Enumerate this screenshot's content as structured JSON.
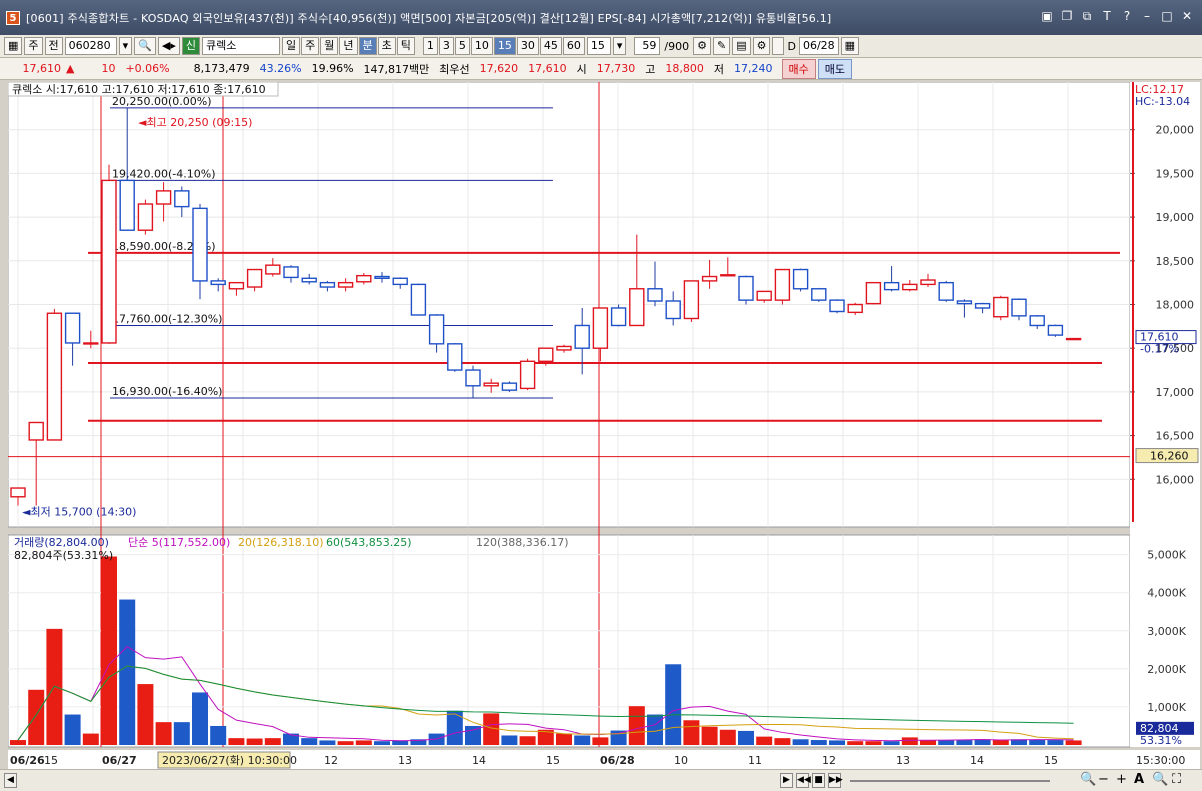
{
  "window": {
    "title": "[0601] 주식종합차트 - KOSDAQ 외국인보유[437(천)] 주식수[40,956(천)] 액면[500] 자본금[205(억)] 결산[12월] EPS[-84] 시가총액[7,212(억)] 유통비율[56.1]",
    "app_icon": "5"
  },
  "toolbar": {
    "market": "주",
    "type": "전",
    "code": "060280",
    "badge": "신",
    "name": "큐렉소",
    "periods": [
      "일",
      "주",
      "월",
      "년",
      "분",
      "초",
      "틱"
    ],
    "period_selected": "분",
    "intervals": [
      "1",
      "3",
      "5",
      "10",
      "15",
      "30",
      "45",
      "60"
    ],
    "interval_selected": "15",
    "interval_value": "15",
    "count": "59",
    "count_total": "/900",
    "d_label": "D",
    "date": "06/28"
  },
  "quote": {
    "price": "17,610",
    "arrow": "▲",
    "change": "10",
    "change_pct": "+0.06%",
    "volume": "8,173,479",
    "vol_ratio": "43.26%",
    "turnover": "19.96%",
    "amount": "147,817백만",
    "best_label": "최우선",
    "ask": "17,620",
    "bid": "17,610",
    "open_label": "시",
    "open": "17,730",
    "high_label": "고",
    "high": "18,800",
    "low_label": "저",
    "low": "17,240",
    "buy_label": "매수",
    "sell_label": "매도"
  },
  "chart_data": {
    "type": "candlestick",
    "title": "큐렉소 시:17,610 고:17,610 저:17,610 종:17,610",
    "legend_name": "큐렉소",
    "y_ticks": [
      16000,
      16500,
      17000,
      17500,
      18000,
      18500,
      19000,
      19500,
      20000
    ],
    "ylim": [
      15500,
      20500
    ],
    "upper_label": "LC:12.17",
    "upper_label2": "HC:-13.04",
    "last_price": "17,610",
    "last_pct": "-0.17%",
    "hline_label": "16,260",
    "high_marker": "최고 20,250 (09:15)",
    "low_marker": "최저 15,700 (14:30)",
    "fib_levels": [
      {
        "price": 20250,
        "label": "20,250.00(0.00%)"
      },
      {
        "price": 19420,
        "label": "19,420.00(-4.10%)"
      },
      {
        "price": 18590,
        "label": "18,590.00(-8.20%)"
      },
      {
        "price": 17760,
        "label": "17,760.00(-12.30%)"
      },
      {
        "price": 16930,
        "label": "16,930.00(-16.40%)"
      }
    ],
    "red_hlines": [
      18590,
      17330,
      16670,
      16260
    ],
    "candles": [
      {
        "o": 15800,
        "h": 15900,
        "l": 15700,
        "c": 15900
      },
      {
        "o": 16450,
        "h": 16650,
        "l": 15700,
        "c": 16650
      },
      {
        "o": 16450,
        "h": 17950,
        "l": 16450,
        "c": 17900
      },
      {
        "o": 17900,
        "h": 17900,
        "l": 17300,
        "c": 17560
      },
      {
        "o": 17560,
        "h": 17700,
        "l": 17500,
        "c": 17560
      },
      {
        "o": 17560,
        "h": 19600,
        "l": 17550,
        "c": 19420
      },
      {
        "o": 19420,
        "h": 20250,
        "l": 18850,
        "c": 18850
      },
      {
        "o": 18850,
        "h": 19200,
        "l": 18800,
        "c": 19150
      },
      {
        "o": 19150,
        "h": 19400,
        "l": 18950,
        "c": 19300
      },
      {
        "o": 19300,
        "h": 19350,
        "l": 19000,
        "c": 19120
      },
      {
        "o": 19100,
        "h": 19150,
        "l": 18060,
        "c": 18270
      },
      {
        "o": 18270,
        "h": 18300,
        "l": 18150,
        "c": 18230
      },
      {
        "o": 18180,
        "h": 18250,
        "l": 18100,
        "c": 18250
      },
      {
        "o": 18200,
        "h": 18400,
        "l": 18150,
        "c": 18400
      },
      {
        "o": 18350,
        "h": 18530,
        "l": 18320,
        "c": 18450
      },
      {
        "o": 18430,
        "h": 18450,
        "l": 18250,
        "c": 18310
      },
      {
        "o": 18300,
        "h": 18350,
        "l": 18230,
        "c": 18260
      },
      {
        "o": 18250,
        "h": 18270,
        "l": 18150,
        "c": 18200
      },
      {
        "o": 18200,
        "h": 18300,
        "l": 18150,
        "c": 18250
      },
      {
        "o": 18260,
        "h": 18360,
        "l": 18230,
        "c": 18330
      },
      {
        "o": 18320,
        "h": 18370,
        "l": 18250,
        "c": 18300
      },
      {
        "o": 18300,
        "h": 18310,
        "l": 18180,
        "c": 18230
      },
      {
        "o": 18230,
        "h": 18240,
        "l": 17880,
        "c": 17880
      },
      {
        "o": 17880,
        "h": 17890,
        "l": 17450,
        "c": 17550
      },
      {
        "o": 17550,
        "h": 17560,
        "l": 17230,
        "c": 17250
      },
      {
        "o": 17250,
        "h": 17300,
        "l": 16930,
        "c": 17070
      },
      {
        "o": 17070,
        "h": 17150,
        "l": 16990,
        "c": 17100
      },
      {
        "o": 17100,
        "h": 17120,
        "l": 17000,
        "c": 17020
      },
      {
        "o": 17040,
        "h": 17380,
        "l": 17020,
        "c": 17350
      },
      {
        "o": 17350,
        "h": 17500,
        "l": 17300,
        "c": 17500
      },
      {
        "o": 17480,
        "h": 17540,
        "l": 17450,
        "c": 17520
      },
      {
        "o": 17760,
        "h": 17960,
        "l": 17200,
        "c": 17500
      },
      {
        "o": 17500,
        "h": 17960,
        "l": 17350,
        "c": 17960
      },
      {
        "o": 17960,
        "h": 18000,
        "l": 17750,
        "c": 17760
      },
      {
        "o": 17760,
        "h": 18800,
        "l": 17760,
        "c": 18180
      },
      {
        "o": 18180,
        "h": 18490,
        "l": 17980,
        "c": 18040
      },
      {
        "o": 18040,
        "h": 18150,
        "l": 17760,
        "c": 17840
      },
      {
        "o": 17840,
        "h": 18270,
        "l": 17800,
        "c": 18270
      },
      {
        "o": 18270,
        "h": 18510,
        "l": 18180,
        "c": 18320
      },
      {
        "o": 18330,
        "h": 18540,
        "l": 18320,
        "c": 18340
      },
      {
        "o": 18320,
        "h": 18330,
        "l": 18000,
        "c": 18050
      },
      {
        "o": 18050,
        "h": 18150,
        "l": 18020,
        "c": 18150
      },
      {
        "o": 18050,
        "h": 18400,
        "l": 18000,
        "c": 18400
      },
      {
        "o": 18400,
        "h": 18410,
        "l": 18150,
        "c": 18180
      },
      {
        "o": 18180,
        "h": 18190,
        "l": 18030,
        "c": 18050
      },
      {
        "o": 18050,
        "h": 18060,
        "l": 17900,
        "c": 17920
      },
      {
        "o": 17910,
        "h": 18020,
        "l": 17880,
        "c": 18000
      },
      {
        "o": 18010,
        "h": 18250,
        "l": 18000,
        "c": 18250
      },
      {
        "o": 18250,
        "h": 18440,
        "l": 18150,
        "c": 18170
      },
      {
        "o": 18170,
        "h": 18280,
        "l": 18150,
        "c": 18230
      },
      {
        "o": 18230,
        "h": 18350,
        "l": 18200,
        "c": 18280
      },
      {
        "o": 18250,
        "h": 18270,
        "l": 18030,
        "c": 18050
      },
      {
        "o": 18040,
        "h": 18060,
        "l": 17850,
        "c": 18010
      },
      {
        "o": 18010,
        "h": 18020,
        "l": 17900,
        "c": 17960
      },
      {
        "o": 17860,
        "h": 18100,
        "l": 17820,
        "c": 18080
      },
      {
        "o": 18060,
        "h": 18070,
        "l": 17820,
        "c": 17870
      },
      {
        "o": 17870,
        "h": 17880,
        "l": 17720,
        "c": 17760
      },
      {
        "o": 17760,
        "h": 17770,
        "l": 17630,
        "c": 17650
      },
      {
        "o": 17610,
        "h": 17610,
        "l": 17610,
        "c": 17610
      }
    ],
    "volume": {
      "header_label": "거래량(82,804.00)",
      "ma_labels": [
        "단순 5(117,552.00)",
        "20(126,318.10)",
        "60(543,853.25)",
        "120(388,336.17)"
      ],
      "sub_label": "82,804주(53.31%)",
      "y_ticks": [
        "5,000K",
        "4,000K",
        "3,000K",
        "2,000K",
        "1,000K"
      ],
      "ymax": 5200,
      "last_value": "82,804",
      "last_pct": "53.31%",
      "values": [
        130,
        1450,
        3050,
        800,
        300,
        4950,
        3820,
        1600,
        600,
        600,
        1380,
        500,
        180,
        170,
        180,
        300,
        180,
        120,
        100,
        120,
        100,
        120,
        150,
        300,
        900,
        500,
        830,
        250,
        230,
        400,
        300,
        250,
        200,
        380,
        1020,
        800,
        2120,
        650,
        480,
        400,
        370,
        220,
        180,
        150,
        130,
        120,
        100,
        100,
        100,
        200,
        120,
        120,
        130,
        150,
        130,
        150,
        140,
        130,
        120
      ]
    },
    "x_labels": [
      "06/26",
      "15",
      "06/27",
      "2023/06/27(화) 10:30:00",
      "12",
      "13",
      "14",
      "15",
      "06/28",
      "10",
      "11",
      "12",
      "13",
      "14",
      "15",
      "15:30:00"
    ]
  },
  "scroll": {
    "buttons": [
      "◀",
      "▶",
      "◀◀",
      "■",
      "▶▶"
    ],
    "zoom_minus": "−",
    "zoom_plus": "+",
    "font_a": "A"
  }
}
